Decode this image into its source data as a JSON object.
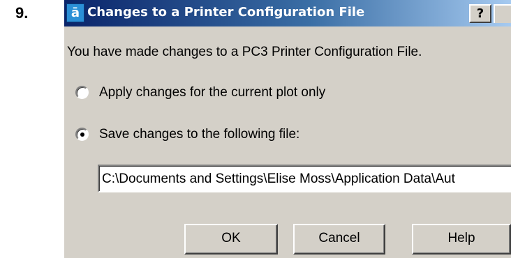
{
  "step": {
    "number": "9."
  },
  "dialog": {
    "title": "Changes to a Printer Configuration File",
    "help_button": "?",
    "message": "You have made changes to a PC3 Printer Configuration File.",
    "options": [
      {
        "label": "Apply changes for the current plot only",
        "selected": false
      },
      {
        "label": "Save changes to the following file:",
        "selected": true
      }
    ],
    "file_path": "C:\\Documents and Settings\\Elise Moss\\Application Data\\Aut",
    "buttons": {
      "ok": "OK",
      "cancel": "Cancel",
      "help": "Help"
    }
  },
  "colors": {
    "titlebar_start": "#0a246a",
    "titlebar_end": "#a6caf0",
    "dialog_face": "#d4d0c8"
  },
  "icons": {
    "app": "autocad-app-icon",
    "radio_selected": "radio-selected-icon",
    "radio_unselected": "radio-unselected-icon"
  }
}
